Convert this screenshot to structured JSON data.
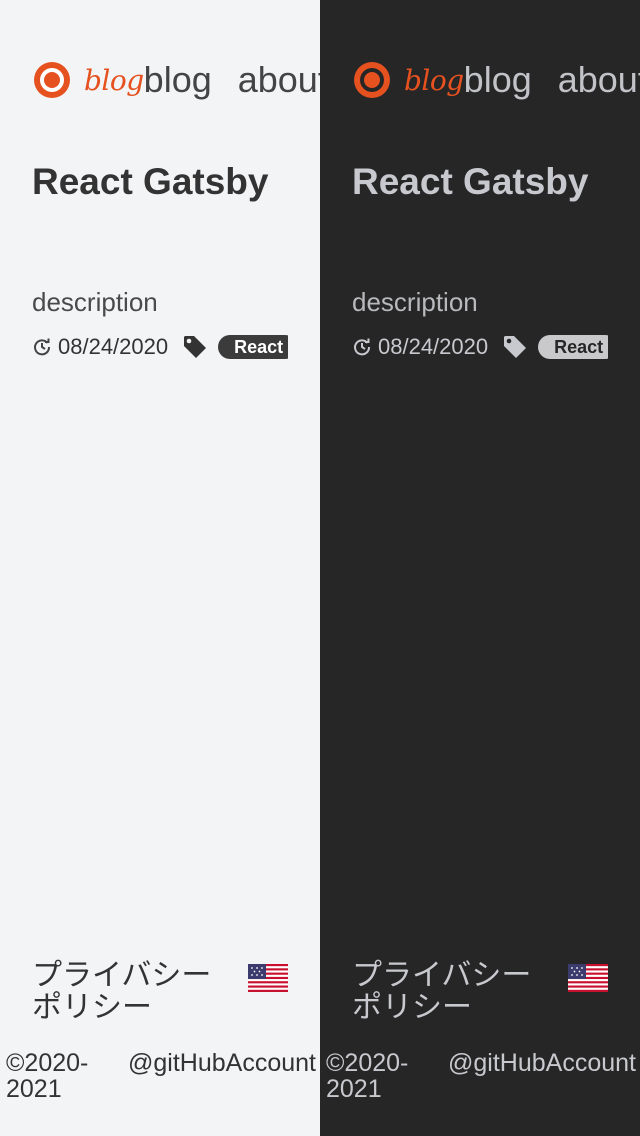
{
  "header": {
    "logo_text": "blog",
    "nav": {
      "blog": "blog",
      "about": "about"
    }
  },
  "post": {
    "title": "React Gatsby",
    "description": "description",
    "date": "08/24/2020",
    "tag": "React"
  },
  "footer": {
    "privacy": "プライバシーポリシー",
    "language_flag": "us-flag-icon",
    "copyright": "©2020-2021",
    "account": "@gitHubAccount"
  },
  "theme": {
    "light_bg": "#f3f4f6",
    "dark_bg": "#262626",
    "accent": "#e5511f"
  }
}
